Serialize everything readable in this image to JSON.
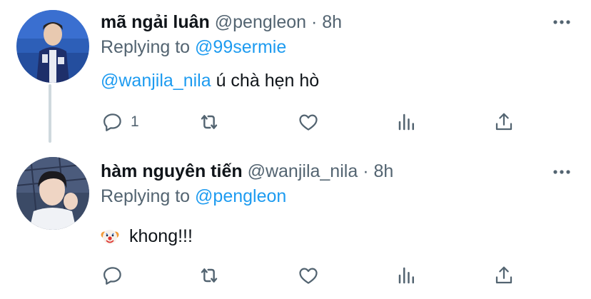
{
  "tweets": [
    {
      "name": "mã ngải luân",
      "handle": "@pengleon",
      "dot": "·",
      "time": "8h",
      "replying_prefix": "Replying to ",
      "replying_to": "@99sermie",
      "mention": "@wanjila_nila",
      "text": " ú chà hẹn hò",
      "reply_count": "1",
      "avatar": "avatar-photo"
    },
    {
      "name": "hàm nguyên tiến",
      "handle": "@wanjila_nila",
      "dot": "·",
      "time": "8h",
      "replying_prefix": "Replying to ",
      "replying_to": "@pengleon",
      "emoji": "clown-face-emoji",
      "text": "khong!!!",
      "reply_count": "",
      "avatar": "avatar-photo"
    }
  ],
  "icons": [
    "reply-icon",
    "retweet-icon",
    "like-icon",
    "analytics-icon",
    "share-icon",
    "more-icon"
  ],
  "colors": {
    "text": "#0f1419",
    "muted": "#536471",
    "link": "#1d9bf0",
    "thread_line": "#cfd9de"
  }
}
